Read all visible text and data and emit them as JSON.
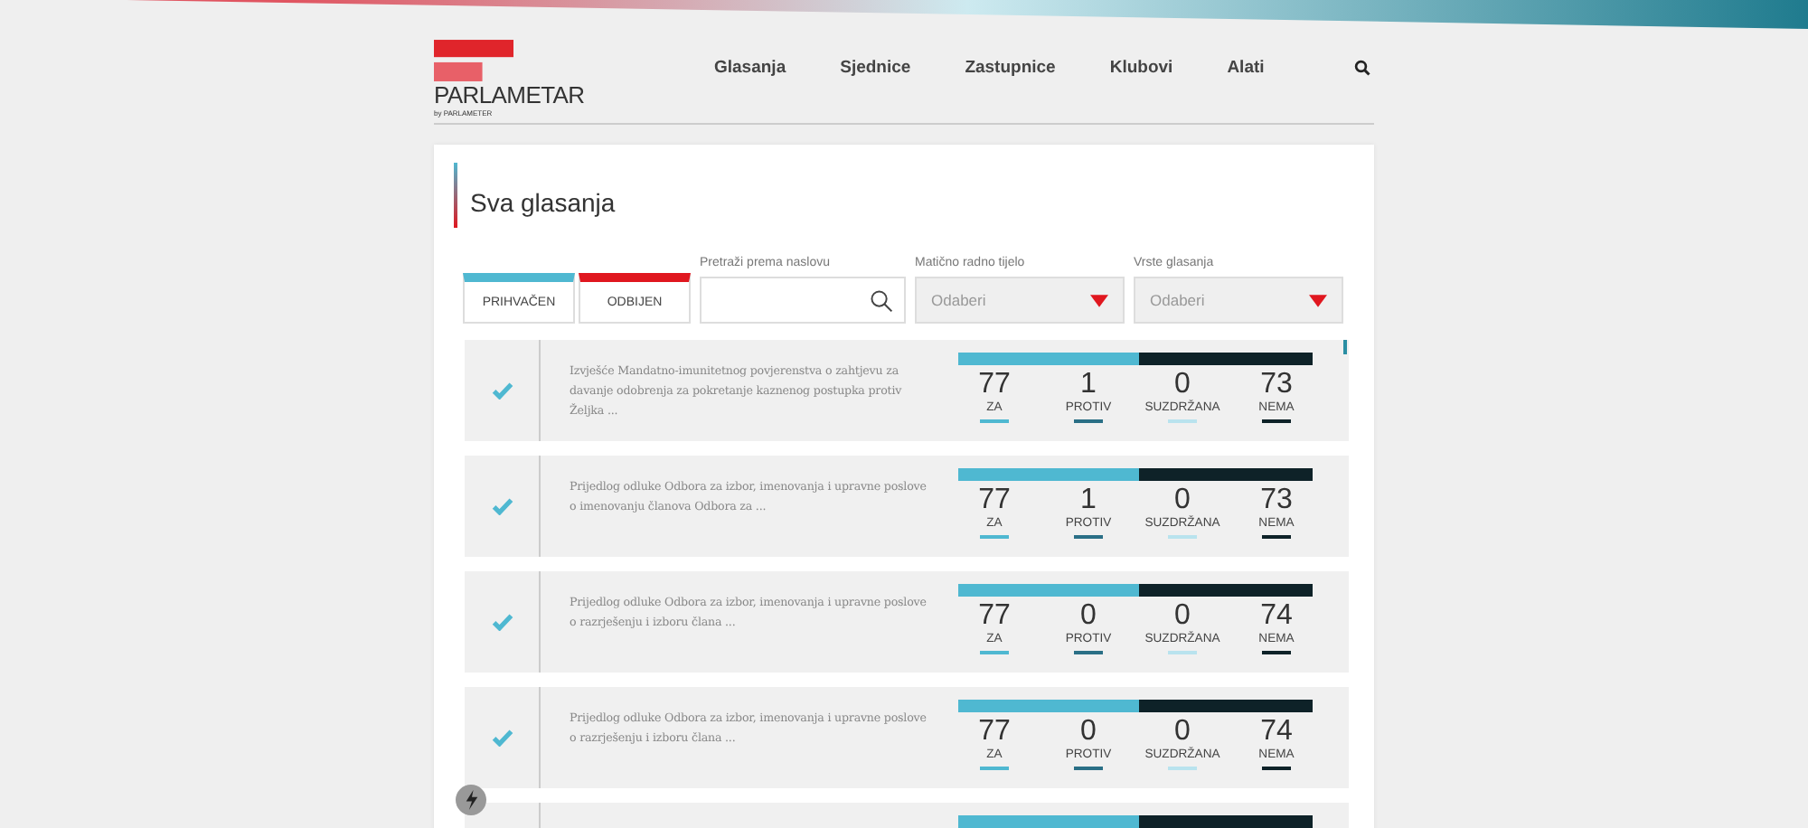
{
  "logo": {
    "name": "PARLAMETAR",
    "tagline": "by PARLAMETER"
  },
  "nav": [
    "Glasanja",
    "Sjednice",
    "Zastupnice",
    "Klubovi",
    "Alati"
  ],
  "title": "Sva glasanja",
  "result_filters": [
    {
      "label": "PRIHVAČEN",
      "color": "#4fb8d1"
    },
    {
      "label": "ODBIJEN",
      "color": "#e0171f"
    }
  ],
  "search": {
    "label": "Pretraži prema naslovu"
  },
  "dropdowns": [
    {
      "label": "Matično radno tijelo",
      "value": "Odaberi"
    },
    {
      "label": "Vrste glasanja",
      "value": "Odaberi"
    }
  ],
  "votes": [
    {
      "accepted": true,
      "title": "Izvješće Mandatno-imunitetnog povjerenstva o zahtjevu za davanje odobrenja za pokretanje kaznenog postupka protiv Željka ...",
      "level": 0.51,
      "counts": [
        {
          "value": "77",
          "label": "ZA"
        },
        {
          "value": "1",
          "label": "PROTIV"
        },
        {
          "value": "0",
          "label": "SUZDRŽANA"
        },
        {
          "value": "73",
          "label": "NEMA"
        }
      ]
    },
    {
      "accepted": true,
      "title": "Prijedlog odluke Odbora za izbor, imenovanja i upravne poslove o imenovanju članova Odbora za ...",
      "level": 0.51,
      "counts": [
        {
          "value": "77",
          "label": "ZA"
        },
        {
          "value": "1",
          "label": "PROTIV"
        },
        {
          "value": "0",
          "label": "SUZDRŽANA"
        },
        {
          "value": "73",
          "label": "NEMA"
        }
      ]
    },
    {
      "accepted": true,
      "title": "Prijedlog odluke Odbora za izbor, imenovanja i upravne poslove o razrješenju i izboru člana ...",
      "level": 0.51,
      "counts": [
        {
          "value": "77",
          "label": "ZA"
        },
        {
          "value": "0",
          "label": "PROTIV"
        },
        {
          "value": "0",
          "label": "SUZDRŽANA"
        },
        {
          "value": "74",
          "label": "NEMA"
        }
      ]
    },
    {
      "accepted": true,
      "title": "Prijedlog odluke Odbora za izbor, imenovanja i upravne poslove o razrješenju i izboru člana ...",
      "level": 0.51,
      "counts": [
        {
          "value": "77",
          "label": "ZA"
        },
        {
          "value": "0",
          "label": "PROTIV"
        },
        {
          "value": "0",
          "label": "SUZDRŽANA"
        },
        {
          "value": "74",
          "label": "NEMA"
        }
      ]
    },
    {
      "level": 0.51
    }
  ]
}
